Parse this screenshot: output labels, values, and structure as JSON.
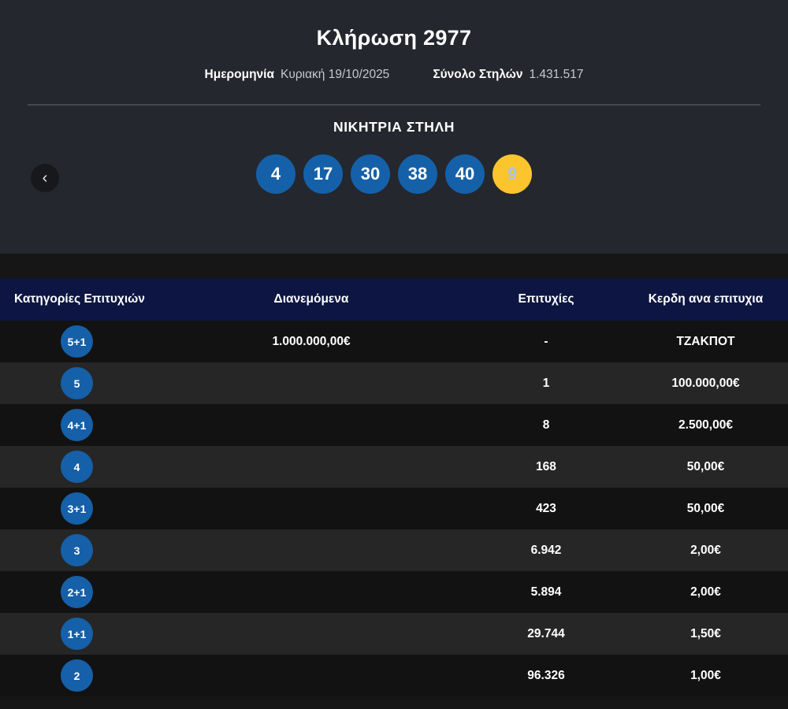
{
  "header": {
    "title": "Κλήρωση 2977",
    "date_label": "Ημερομηνία",
    "date_value": "Κυριακή 19/10/2025",
    "columns_label": "Σύνολο Στηλών",
    "columns_value": "1.431.517"
  },
  "winning": {
    "title": "ΝΙΚΗΤΡΙΑ ΣΤΗΛΗ",
    "prev_arrow": "‹",
    "numbers": [
      "4",
      "17",
      "30",
      "38",
      "40"
    ],
    "bonus": "9"
  },
  "colors": {
    "panel_bg": "#24272d",
    "page_bg": "#161616",
    "table_header_bg": "#0d1642",
    "ball_blue": "#1561a9",
    "ball_yellow": "#fdc52d",
    "bonus_text": "#a9c4e6",
    "row_dark": "#121212",
    "row_light": "#262626"
  },
  "table": {
    "headers": {
      "category": "Κατηγορίες Επιτυχιών",
      "distributed": "Διανεμόμενα",
      "wins": "Επιτυχίες",
      "prize": "Κερδη ανα επιτυχια"
    },
    "rows": [
      {
        "category": "5+1",
        "distributed": "1.000.000,00€",
        "wins": "-",
        "prize": "ΤΖΑΚΠΟΤ"
      },
      {
        "category": "5",
        "distributed": "",
        "wins": "1",
        "prize": "100.000,00€"
      },
      {
        "category": "4+1",
        "distributed": "",
        "wins": "8",
        "prize": "2.500,00€"
      },
      {
        "category": "4",
        "distributed": "",
        "wins": "168",
        "prize": "50,00€"
      },
      {
        "category": "3+1",
        "distributed": "",
        "wins": "423",
        "prize": "50,00€"
      },
      {
        "category": "3",
        "distributed": "",
        "wins": "6.942",
        "prize": "2,00€"
      },
      {
        "category": "2+1",
        "distributed": "",
        "wins": "5.894",
        "prize": "2,00€"
      },
      {
        "category": "1+1",
        "distributed": "",
        "wins": "29.744",
        "prize": "1,50€"
      },
      {
        "category": "2",
        "distributed": "",
        "wins": "96.326",
        "prize": "1,00€"
      }
    ]
  }
}
